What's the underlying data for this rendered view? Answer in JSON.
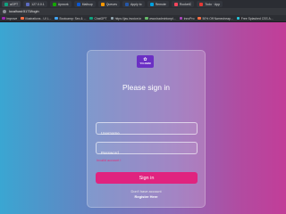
{
  "browser": {
    "tabs": [
      {
        "label": "aGPT",
        "color": "#10a37f"
      },
      {
        "label": "127.0.0.1",
        "color": "#5c6bc0"
      },
      {
        "label": "Upwork",
        "color": "#14a800"
      },
      {
        "label": "Mailsup",
        "color": "#0b57d0"
      },
      {
        "label": "Queues",
        "color": "#ff9800"
      },
      {
        "label": "Apply to",
        "color": "#2557a7"
      },
      {
        "label": "Remote",
        "color": "#00a1e0"
      },
      {
        "label": "RocketC",
        "color": "#f5455c"
      },
      {
        "label": "Todo · App",
        "color": "#e53935"
      }
    ],
    "address": "localhost:5173/login",
    "bookmarks": [
      {
        "label": "Improve",
        "color": "#9c27b0"
      },
      {
        "label": "Illustrations - UI L...",
        "color": "#ff7043"
      },
      {
        "label": "Bootcamp: Sec & ...",
        "color": "#42a5f5"
      },
      {
        "label": "ChatGPT",
        "color": "#10a37f"
      },
      {
        "label": "https://jas.invoice.in",
        "color": "#90a4ae"
      },
      {
        "label": "www.badmintonpl...",
        "color": "#66bb6a"
      },
      {
        "label": "InnoPro",
        "color": "#ab47bc"
      },
      {
        "label": "50% Off Namecheap...",
        "color": "#ff7043"
      },
      {
        "label": "Free Splashed CSS A...",
        "color": "#26c6da"
      }
    ]
  },
  "login": {
    "logo_glyph": "✿",
    "logo_text": "YO-OHM",
    "title": "Please sign in",
    "username_placeholder": "Username",
    "password_placeholder": "Password",
    "error": "Invalid account !",
    "signin_label": "Sign in",
    "no_account": "Don't have account",
    "register_label": "Register Here"
  }
}
